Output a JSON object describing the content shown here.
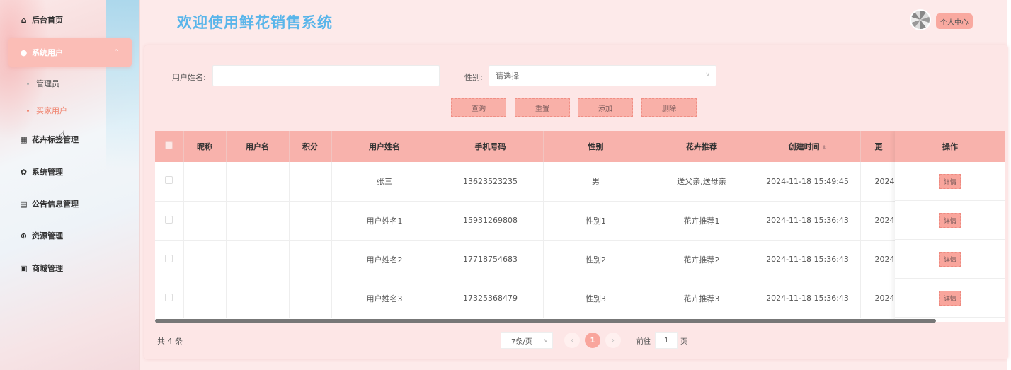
{
  "sidebar": {
    "items": [
      {
        "label": "后台首页",
        "icon": "home-icon"
      },
      {
        "label": "系统用户",
        "icon": "user-icon"
      },
      {
        "label": "花卉标签管理",
        "icon": "grid-icon"
      },
      {
        "label": "系统管理",
        "icon": "gear-icon"
      },
      {
        "label": "公告信息管理",
        "icon": "document-icon"
      },
      {
        "label": "资源管理",
        "icon": "plus-circle-icon"
      },
      {
        "label": "商城管理",
        "icon": "mail-icon"
      }
    ],
    "sub_items": [
      {
        "label": "管理员"
      },
      {
        "label": "买家用户"
      }
    ]
  },
  "header": {
    "title": "欢迎使用鲜花销售系统",
    "profile_label": "个人中心"
  },
  "search": {
    "name_label": "用户姓名:",
    "name_value": "",
    "gender_label": "性别:",
    "gender_placeholder": "请选择"
  },
  "buttons": {
    "query": "查询",
    "reset": "重置",
    "add": "添加",
    "delete": "删除"
  },
  "table": {
    "columns": [
      "昵称",
      "用户名",
      "积分",
      "用户姓名",
      "手机号码",
      "性别",
      "花卉推荐",
      "创建时间",
      "更"
    ],
    "op_header": "操作",
    "detail_label": "详情",
    "rows": [
      {
        "nickname": "",
        "username": "",
        "points": "",
        "name": "张三",
        "phone": "13623523235",
        "gender": "男",
        "recommend": "送父亲,送母亲",
        "created": "2024-11-18 15:49:45",
        "updated": "2024-"
      },
      {
        "nickname": "",
        "username": "",
        "points": "",
        "name": "用户姓名1",
        "phone": "15931269808",
        "gender": "性别1",
        "recommend": "花卉推荐1",
        "created": "2024-11-18 15:36:43",
        "updated": "2024-"
      },
      {
        "nickname": "",
        "username": "",
        "points": "",
        "name": "用户姓名2",
        "phone": "17718754683",
        "gender": "性别2",
        "recommend": "花卉推荐2",
        "created": "2024-11-18 15:36:43",
        "updated": "2024-"
      },
      {
        "nickname": "",
        "username": "",
        "points": "",
        "name": "用户姓名3",
        "phone": "17325368479",
        "gender": "性别3",
        "recommend": "花卉推荐3",
        "created": "2024-11-18 15:36:43",
        "updated": "2024-"
      }
    ]
  },
  "pagination": {
    "total": "共 4 条",
    "page_size": "7条/页",
    "current_page": "1",
    "goto_label": "前往",
    "goto_value": "1",
    "page_suffix": "页"
  },
  "colors": {
    "accent": "#f9a59c",
    "title": "#59b5ea",
    "background": "#fdeaea"
  }
}
